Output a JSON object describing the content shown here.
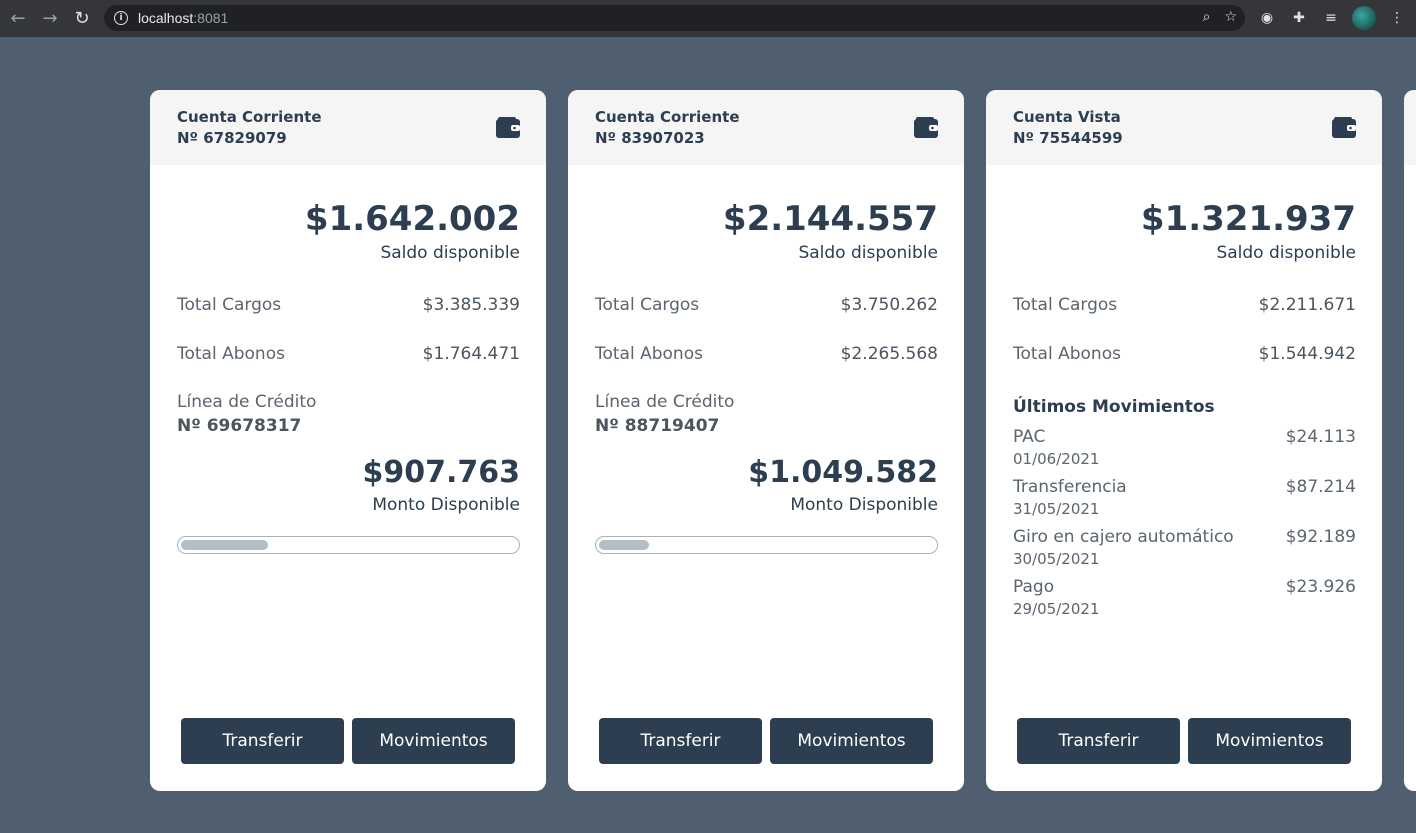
{
  "browser": {
    "url_host": "localhost",
    "url_port": ":8081"
  },
  "accounts": [
    {
      "type": "Cuenta Corriente",
      "number": "Nº 67829079",
      "balance": "$1.642.002",
      "balance_label": "Saldo disponible",
      "cargos_label": "Total Cargos",
      "cargos": "$3.385.339",
      "abonos_label": "Total Abonos",
      "abonos": "$1.764.471",
      "credit_label": "Línea de Crédito",
      "credit_number": "Nº 69678317",
      "credit_amount": "$907.763",
      "credit_amount_label": "Monto Disponible",
      "credit_progress_pct": 26,
      "transfer_label": "Transferir",
      "movements_label": "Movimientos"
    },
    {
      "type": "Cuenta Corriente",
      "number": "Nº 83907023",
      "balance": "$2.144.557",
      "balance_label": "Saldo disponible",
      "cargos_label": "Total Cargos",
      "cargos": "$3.750.262",
      "abonos_label": "Total Abonos",
      "abonos": "$2.265.568",
      "credit_label": "Línea de Crédito",
      "credit_number": "Nº 88719407",
      "credit_amount": "$1.049.582",
      "credit_amount_label": "Monto Disponible",
      "credit_progress_pct": 15,
      "transfer_label": "Transferir",
      "movements_label": "Movimientos"
    },
    {
      "type": "Cuenta Vista",
      "number": "Nº 75544599",
      "balance": "$1.321.937",
      "balance_label": "Saldo disponible",
      "cargos_label": "Total Cargos",
      "cargos": "$2.211.671",
      "abonos_label": "Total Abonos",
      "abonos": "$1.544.942",
      "movements_title": "Últimos Movimientos",
      "movements": [
        {
          "desc": "PAC",
          "date": "01/06/2021",
          "amount": "$24.113"
        },
        {
          "desc": "Transferencia",
          "date": "31/05/2021",
          "amount": "$87.214"
        },
        {
          "desc": "Giro en cajero automático",
          "date": "30/05/2021",
          "amount": "$92.189"
        },
        {
          "desc": "Pago",
          "date": "29/05/2021",
          "amount": "$23.926"
        }
      ],
      "transfer_label": "Transferir",
      "movements_label": "Movimientos"
    }
  ],
  "colors": {
    "background": "#4f5f70",
    "primary": "#2c3e50",
    "card": "#ffffff",
    "card_header": "#f5f5f5"
  }
}
